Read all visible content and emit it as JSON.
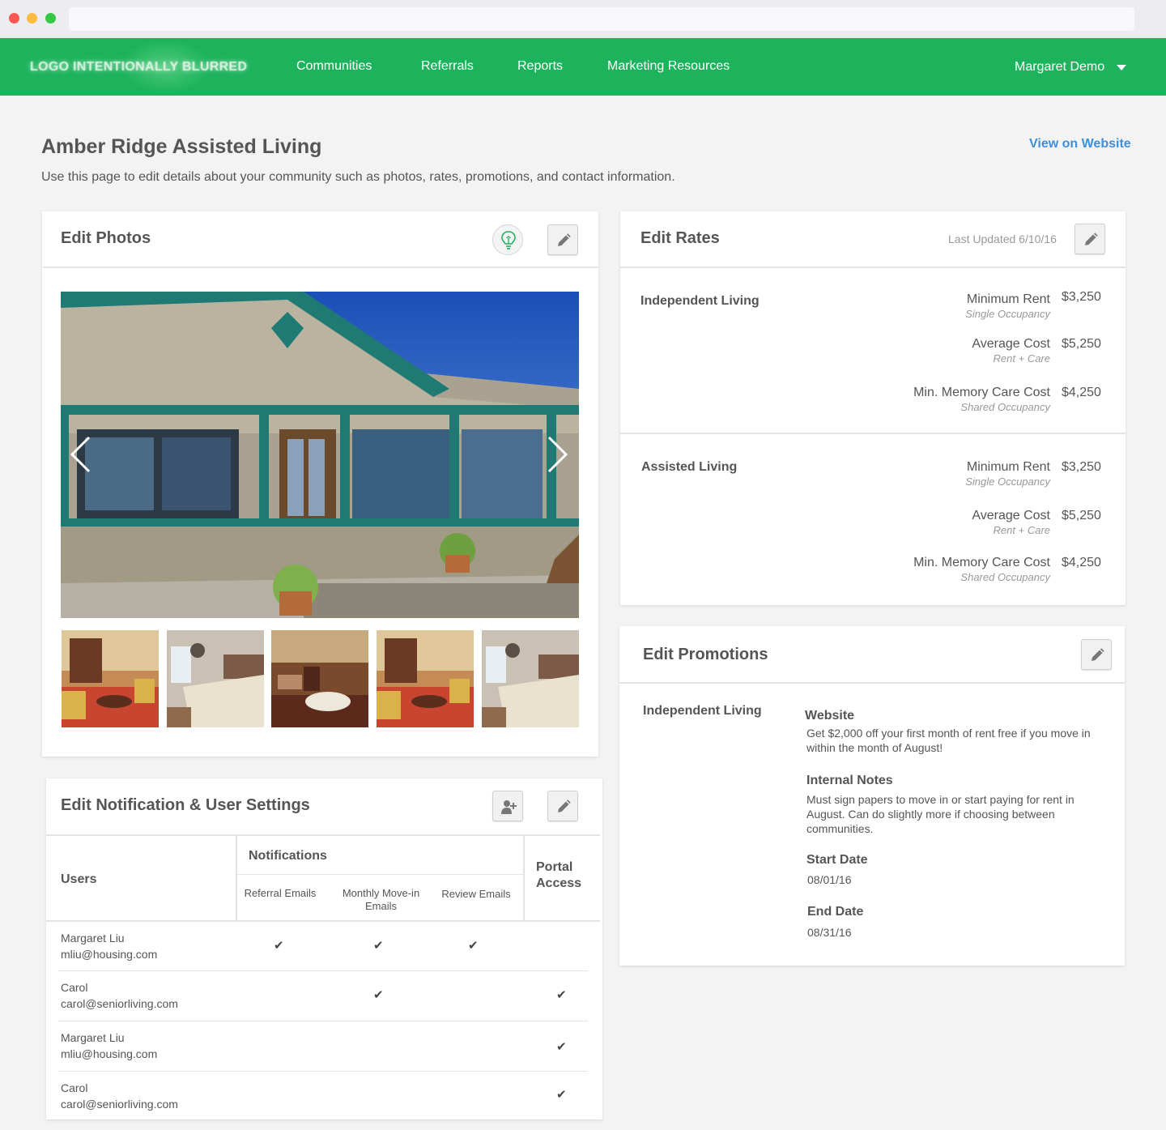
{
  "nav": {
    "logo": "LOGO INTENTIONALLY BLURRED",
    "links": [
      "Communities",
      "Referrals",
      "Reports",
      "Marketing Resources"
    ],
    "user": "Margaret Demo"
  },
  "page": {
    "title": "Amber Ridge Assisted Living",
    "subtitle": "Use this page to edit details about your community such as photos, rates, promotions, and contact information.",
    "view_link": "View on Website"
  },
  "photos": {
    "title": "Edit Photos",
    "icons": [
      "lightbulb-icon",
      "pencil-icon",
      "chevron-left-icon",
      "chevron-right-icon"
    ]
  },
  "rates": {
    "title": "Edit Rates",
    "last_updated": "Last Updated 6/10/16",
    "sections": [
      {
        "name": "Independent Living",
        "rows": [
          {
            "label": "Minimum Rent",
            "sub": "Single Occupancy",
            "value": "$3,250"
          },
          {
            "label": "Average Cost",
            "sub": "Rent + Care",
            "value": "$5,250"
          },
          {
            "label": "Min. Memory Care Cost",
            "sub": "Shared Occupancy",
            "value": "$4,250"
          }
        ]
      },
      {
        "name": "Assisted Living",
        "rows": [
          {
            "label": "Minimum Rent",
            "sub": "Single Occupancy",
            "value": "$3,250"
          },
          {
            "label": "Average Cost",
            "sub": "Rent + Care",
            "value": "$5,250"
          },
          {
            "label": "Min. Memory Care Cost",
            "sub": "Shared Occupancy",
            "value": "$4,250"
          }
        ]
      }
    ]
  },
  "promotions": {
    "title": "Edit Promotions",
    "section": "Independent Living",
    "website_h": "Website",
    "website_t": "Get $2,000 off your first month of rent free if you move in within the month of August!",
    "notes_h": "Internal Notes",
    "notes_t": "Must sign papers to move in or start paying for rent in August. Can do slightly more if choosing between communities.",
    "start_h": "Start Date",
    "start_t": "08/01/16",
    "end_h": "End Date",
    "end_t": "08/31/16"
  },
  "notifications": {
    "title": "Edit Notification & User Settings",
    "col_users": "Users",
    "col_notifications": "Notifications",
    "col_referral": "Referral Emails",
    "col_monthly": "Monthly Move-in Emails",
    "col_review": "Review Emails",
    "col_portal": "Portal Access",
    "check_glyph": "✔",
    "users": [
      {
        "name": "Margaret Liu",
        "email": "mliu@housing.com",
        "referral": true,
        "monthly": true,
        "review": true,
        "portal": false
      },
      {
        "name": "Carol",
        "email": "carol@seniorliving.com",
        "referral": false,
        "monthly": true,
        "review": false,
        "portal": true
      },
      {
        "name": "Margaret Liu",
        "email": "mliu@housing.com",
        "referral": false,
        "monthly": false,
        "review": false,
        "portal": true
      },
      {
        "name": "Carol",
        "email": "carol@seniorliving.com",
        "referral": false,
        "monthly": false,
        "review": false,
        "portal": true
      }
    ]
  },
  "colors": {
    "brand": "#1db35c",
    "link": "#3f8fd8"
  }
}
